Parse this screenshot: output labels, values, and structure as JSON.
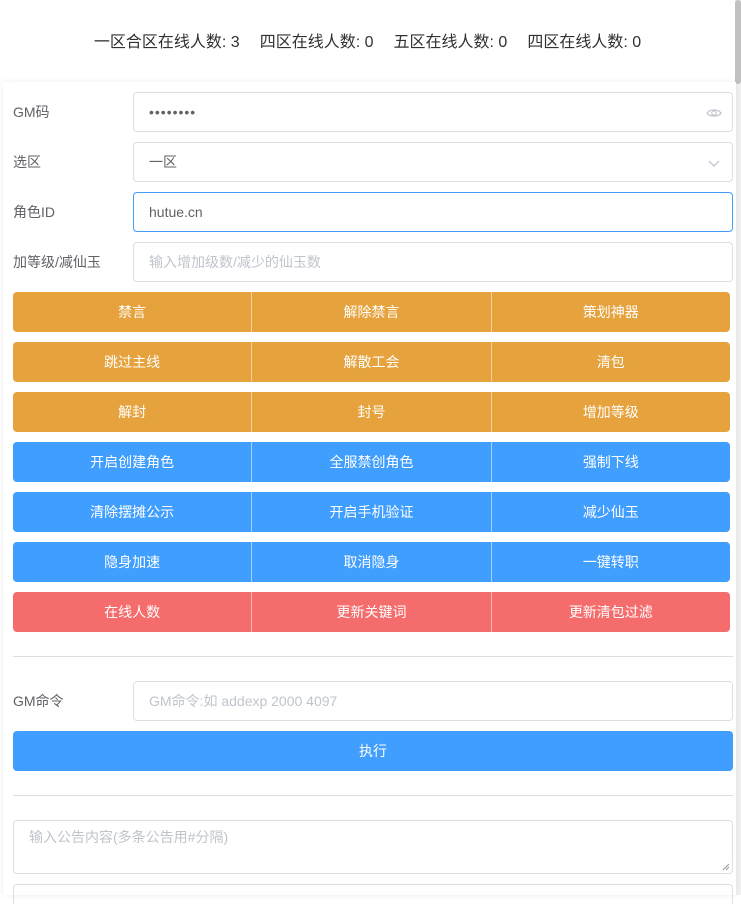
{
  "online": {
    "zone1_label": "一区合区在线人数:",
    "zone1_value": "3",
    "zone4_label": "四区在线人数:",
    "zone4_value": "0",
    "zone5_label": "五区在线人数:",
    "zone5_value": "0",
    "zone4b_label": "四区在线人数:",
    "zone4b_value": "0"
  },
  "form": {
    "gm_code_label": "GM码",
    "gm_code_value": "••••••••",
    "zone_label": "选区",
    "zone_value": "一区",
    "role_id_label": "角色ID",
    "role_id_value": "hutue.cn",
    "level_label": "加等级/减仙玉",
    "level_placeholder": "输入增加级数/减少的仙玉数"
  },
  "buttons": {
    "row1": [
      "禁言",
      "解除禁言",
      "策划神器"
    ],
    "row2": [
      "跳过主线",
      "解散工会",
      "清包"
    ],
    "row3": [
      "解封",
      "封号",
      "增加等级"
    ],
    "row4": [
      "开启创建角色",
      "全服禁创角色",
      "强制下线"
    ],
    "row5": [
      "清除摆摊公示",
      "开启手机验证",
      "减少仙玉"
    ],
    "row6": [
      "隐身加速",
      "取消隐身",
      "一键转职"
    ],
    "row7": [
      "在线人数",
      "更新关键词",
      "更新清包过滤"
    ]
  },
  "gm_command": {
    "label": "GM命令",
    "placeholder": "GM命令:如 addexp 2000 4097",
    "execute_label": "执行"
  },
  "announcement": {
    "placeholder": "输入公告内容(多条公告用#分隔)"
  },
  "colors": {
    "orange": "#e6a23c",
    "blue": "#409eff",
    "red": "#f56c6c"
  }
}
